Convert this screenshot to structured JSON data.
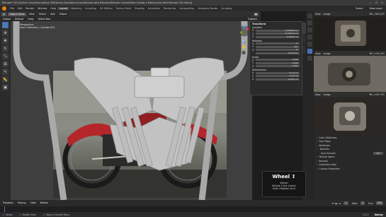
{
  "titlebar": {
    "title": "Blender* [D:\\Online Courses\\Creative 3D\\Harley-Davidson Knucklehead with Blender\\Blender Scene\\Mod Create a Motorcycle with Blender 3D.blend]",
    "min": "—",
    "max": "☐",
    "close": "✕"
  },
  "menu": {
    "items": [
      "File",
      "Edit",
      "Render",
      "Window",
      "Help"
    ],
    "workspaces": [
      "Layout",
      "Modeling",
      "Sculpting",
      "UV Editing",
      "Texture Paint",
      "Shading",
      "Animation",
      "Rendering",
      "Compositing",
      "Geometry Nodes",
      "Scripting"
    ],
    "active_workspace": "Layout",
    "scene_label": "Scene",
    "viewlayer_label": "View Layer"
  },
  "header": {
    "mode": "Object Mode",
    "view": "View",
    "select": "Select",
    "add": "Add",
    "object": "Object",
    "orientation": "Global",
    "pivot": "Default",
    "drag": "Drag",
    "select_box": "Select Box",
    "options": "Options"
  },
  "viewport": {
    "view_name": "User Perspective",
    "collection": "(1) Scene Collection | Cylinder.001"
  },
  "props": {
    "transform_title": "Transform",
    "location_label": "Location",
    "location": [
      {
        "axis": "X",
        "value": "0.000823 m"
      },
      {
        "axis": "Y",
        "value": "-0.047012 m"
      },
      {
        "axis": "Z",
        "value": "0.40301 m"
      }
    ],
    "rotation_label": "Rotation",
    "rotation": [
      {
        "axis": "X",
        "value": "0°"
      },
      {
        "axis": "Y",
        "value": "-90°"
      },
      {
        "axis": "Z",
        "value": "0°"
      }
    ],
    "mode_label": "XYZ Euler",
    "scale_label": "Scale",
    "scale": [
      {
        "axis": "X",
        "value": "1.000"
      },
      {
        "axis": "Y",
        "value": "1.000"
      },
      {
        "axis": "Z",
        "value": "1.000"
      }
    ],
    "dimensions_label": "Dimensions",
    "dimensions": [
      {
        "axis": "X",
        "value": "0.111 m"
      },
      {
        "axis": "Y",
        "value": "0.111 m"
      },
      {
        "axis": "Z",
        "value": "0.0151 m"
      }
    ]
  },
  "tooltip": {
    "title": "Wheel",
    "line1": "Wheel ↕",
    "line2": "Middle Click (Hold)",
    "line3": "Shift+Middle Click"
  },
  "image_panels": [
    {
      "view": "View",
      "image": "Image",
      "name": "IMG_3626.JPG"
    },
    {
      "view": "View",
      "image": "Image",
      "name": "IMG_0063.JPG"
    },
    {
      "view": "View",
      "image": "Image",
      "name": "IMG_0067.JPG"
    }
  ],
  "outliner": {
    "rows": [
      "Color Attributes",
      "Face Maps",
      "Attributes",
      "Normals",
      "Auto Smooth",
      "Texture Space",
      "Remesh",
      "Geometry Data",
      "Custom Properties"
    ],
    "angle_label": "Auto Smooth",
    "angle_value": "30°"
  },
  "timeline": {
    "playback": "Playback",
    "keying": "Keying",
    "view": "View",
    "marker": "Marker",
    "frame": "1",
    "start_label": "Start",
    "start": "1",
    "end_label": "End",
    "end": "250"
  },
  "status": {
    "select": "Select",
    "rotate": "Rotate View",
    "menu": "Object Context Menu",
    "version": "3.4.1",
    "brand": "Udemy"
  },
  "colors": {
    "accent": "#4772b3",
    "header_bg": "#303030",
    "panel_bg": "#2b2b2b",
    "field_bg": "#545454",
    "bike_red": "#b5262a"
  }
}
